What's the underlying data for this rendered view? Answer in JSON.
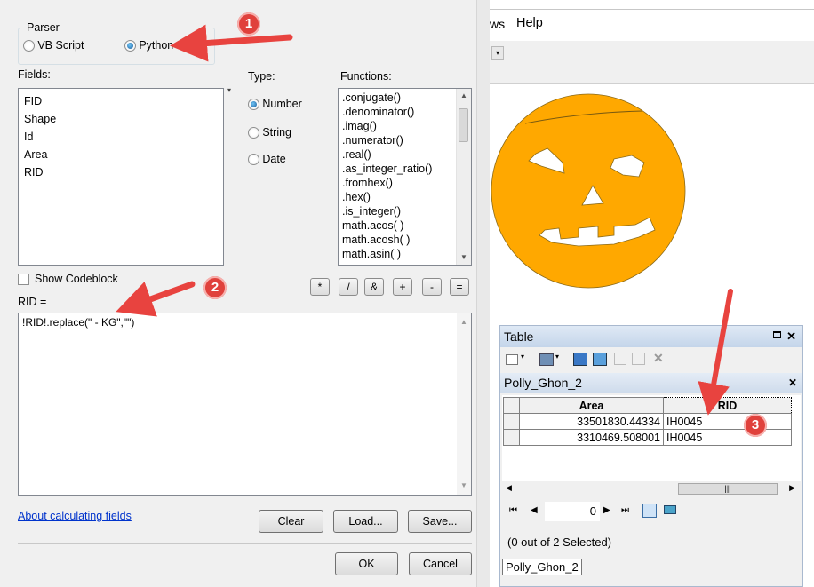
{
  "dialog": {
    "parser_legend": "Parser",
    "parser_options": [
      "VB Script",
      "Python"
    ],
    "parser_selected": "Python",
    "fields_label": "Fields:",
    "fields": [
      "FID",
      "Shape",
      "Id",
      "Area",
      "RID"
    ],
    "type_label": "Type:",
    "types": [
      "Number",
      "String",
      "Date"
    ],
    "type_selected": "Number",
    "functions_label": "Functions:",
    "functions": [
      ".conjugate()",
      ".denominator()",
      ".imag()",
      ".numerator()",
      ".real()",
      ".as_integer_ratio()",
      ".fromhex()",
      ".hex()",
      ".is_integer()",
      "math.acos( )",
      "math.acosh( )",
      "math.asin( )"
    ],
    "show_codeblock_label": "Show Codeblock",
    "operators": [
      "*",
      "/",
      "&",
      "+",
      "-",
      "="
    ],
    "expression_label": "RID =",
    "expression": "!RID!.replace(\" - KG\",\"\")",
    "help_link": "About calculating fields",
    "clear_button": "Clear",
    "load_button": "Load...",
    "save_button": "Save...",
    "ok_button": "OK",
    "cancel_button": "Cancel"
  },
  "callouts": [
    "1",
    "2",
    "3"
  ],
  "arcmap": {
    "menu_partial": "ws",
    "menu_help": "Help"
  },
  "table": {
    "title": "Table",
    "tab_name": "Polly_Ghon_2",
    "columns": [
      "Area",
      "RID"
    ],
    "rows": [
      [
        "33501830.44334",
        "IH0045"
      ],
      [
        "3310469.508001",
        "IH0045"
      ]
    ],
    "record_number": "0",
    "selection_status": "(0 out of 2 Selected)",
    "bottom_tab": "Polly_Ghon_2"
  },
  "colors": {
    "pumpkin": "#ffa800",
    "callout": "#e0413c",
    "arrow": "#e8433f"
  }
}
